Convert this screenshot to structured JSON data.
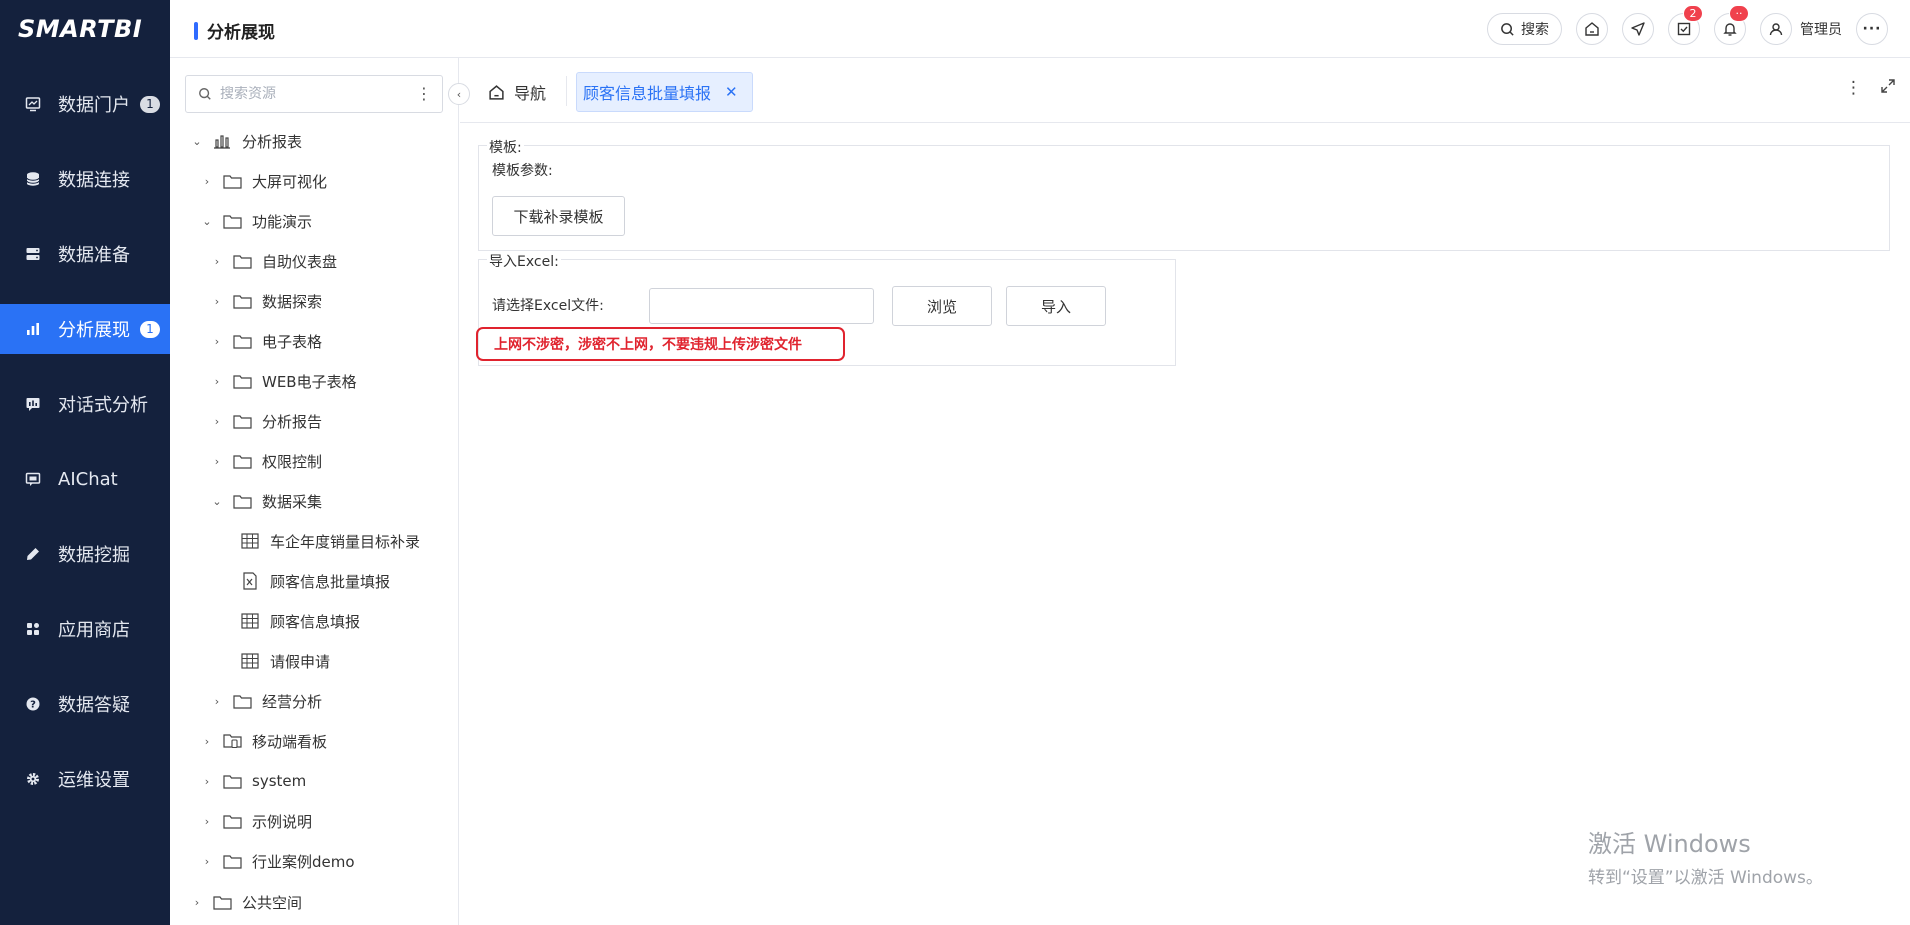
{
  "brand": {
    "logo": "SMARTBI"
  },
  "header": {
    "title": "分析展现",
    "search_label": "搜索",
    "task_badge": "2",
    "notice_badge": "··",
    "user_name": "管理员"
  },
  "nav": {
    "items": [
      {
        "label": "数据门户",
        "badge": "1"
      },
      {
        "label": "数据连接"
      },
      {
        "label": "数据准备"
      },
      {
        "label": "分析展现",
        "badge": "1",
        "active": true
      },
      {
        "label": "对话式分析"
      },
      {
        "label": "AIChat"
      },
      {
        "label": "数据挖掘"
      },
      {
        "label": "应用商店"
      },
      {
        "label": "数据答疑"
      },
      {
        "label": "运维设置"
      }
    ]
  },
  "tree": {
    "search_placeholder": "搜索资源",
    "items": [
      {
        "label": "分析报表",
        "icon": "report-root-icon",
        "expanded": true
      },
      {
        "label": "大屏可视化",
        "icon": "folder-icon"
      },
      {
        "label": "功能演示",
        "icon": "folder-icon",
        "expanded": true
      },
      {
        "label": "自助仪表盘",
        "icon": "folder-icon"
      },
      {
        "label": "数据探索",
        "icon": "folder-icon"
      },
      {
        "label": "电子表格",
        "icon": "folder-icon"
      },
      {
        "label": "WEB电子表格",
        "icon": "folder-icon"
      },
      {
        "label": "分析报告",
        "icon": "folder-icon"
      },
      {
        "label": "权限控制",
        "icon": "folder-icon"
      },
      {
        "label": "数据采集",
        "icon": "folder-icon",
        "expanded": true
      },
      {
        "label": "车企年度销量目标补录",
        "icon": "table-icon"
      },
      {
        "label": "顾客信息批量填报",
        "icon": "excel-import-icon"
      },
      {
        "label": "顾客信息填报",
        "icon": "table-icon"
      },
      {
        "label": "请假申请",
        "icon": "table-icon"
      },
      {
        "label": "经营分析",
        "icon": "folder-icon"
      },
      {
        "label": "移动端看板",
        "icon": "mobile-folder-icon"
      },
      {
        "label": "system",
        "icon": "folder-icon"
      },
      {
        "label": "示例说明",
        "icon": "folder-icon"
      },
      {
        "label": "行业案例demo",
        "icon": "folder-icon"
      },
      {
        "label": "公共空间",
        "icon": "folder-icon"
      }
    ]
  },
  "tabs": {
    "home_label": "导航",
    "active_label": "顾客信息批量填报"
  },
  "template_section": {
    "legend": "模板:",
    "params_label": "模板参数:",
    "download_button": "下载补录模板"
  },
  "import_section": {
    "legend": "导入Excel:",
    "file_label": "请选择Excel文件:",
    "file_value": "",
    "browse_button": "浏览",
    "import_button": "导入",
    "warning": "上网不涉密，涉密不上网，不要违规上传涉密文件"
  },
  "watermark": {
    "line1": "激活 Windows",
    "line2": "转到“设置”以激活 Windows。"
  },
  "colors": {
    "nav_bg": "#14213d",
    "accent": "#2a72f5",
    "warning": "#e0232e"
  }
}
